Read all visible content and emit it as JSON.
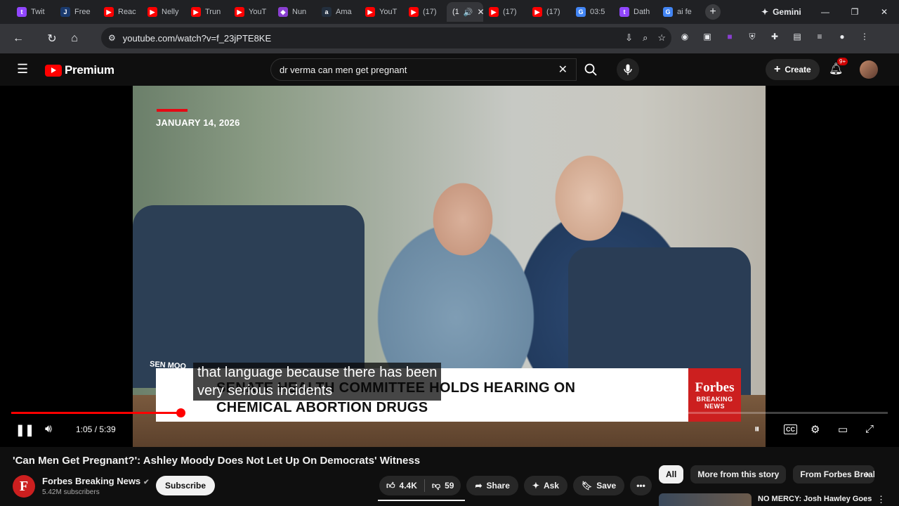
{
  "browser": {
    "tabs": [
      {
        "label": "Twit",
        "icon": "twitch-icon",
        "color": "#9146ff",
        "glyph": "t"
      },
      {
        "label": "Free",
        "icon": "j-icon",
        "color": "#1a3a6e",
        "glyph": "J"
      },
      {
        "label": "Reac",
        "icon": "youtube-icon",
        "color": "#ff0000",
        "glyph": "▶"
      },
      {
        "label": "Nelly",
        "icon": "youtube-icon",
        "color": "#ff0000",
        "glyph": "▶"
      },
      {
        "label": "Trun",
        "icon": "youtube-icon",
        "color": "#ff0000",
        "glyph": "▶"
      },
      {
        "label": "YouT",
        "icon": "youtube-icon",
        "color": "#ff0000",
        "glyph": "▶"
      },
      {
        "label": "Nun",
        "icon": "gem-icon",
        "color": "#8a3fd1",
        "glyph": "◆"
      },
      {
        "label": "Ama",
        "icon": "amazon-icon",
        "color": "#232f3e",
        "glyph": "a"
      },
      {
        "label": "YouT",
        "icon": "youtube-icon",
        "color": "#ff0000",
        "glyph": "▶"
      },
      {
        "label": "(17)",
        "icon": "youtube-icon",
        "color": "#ff0000",
        "glyph": "▶"
      }
    ],
    "active_tab": {
      "label": "(1",
      "icon": "audio-icon"
    },
    "tabs_after": [
      {
        "label": "(17)",
        "icon": "youtube-icon",
        "color": "#ff0000",
        "glyph": "▶"
      },
      {
        "label": "(17)",
        "icon": "youtube-icon",
        "color": "#ff0000",
        "glyph": "▶"
      },
      {
        "label": "03:5",
        "icon": "google-icon",
        "color": "#4285f4",
        "glyph": "G"
      },
      {
        "label": "Dath",
        "icon": "twitch-icon",
        "color": "#9146ff",
        "glyph": "t"
      },
      {
        "label": "ai fe",
        "icon": "google-icon",
        "color": "#4285f4",
        "glyph": "G"
      }
    ],
    "gemini_label": "Gemini",
    "url": "youtube.com/watch?v=f_23jPTE8KE"
  },
  "youtube": {
    "logo_text": "Premium",
    "search_query": "dr verma can men get pregnant",
    "create_label": "Create",
    "notifications_badge": "9+"
  },
  "video": {
    "date_overlay": "JANUARY 14, 2026",
    "lower_third_line1": "SENATE HEALTH COMMITTEE HOLDS HEARING ON",
    "lower_third_line2": "CHEMICAL ABORTION DRUGS",
    "brand_name": "Forbes",
    "brand_sub": "BREAKING NEWS",
    "nameplate": "SEN MOO",
    "caption_line1": "that language because there has been",
    "caption_line2": "very serious incidents",
    "time_display": "1:05 / 5:39",
    "progress_fraction": 0.193,
    "cc_label": "CC"
  },
  "meta": {
    "title": "'Can Men Get Pregnant?': Ashley Moody Does Not Let Up On Democrats' Witness",
    "channel_initial": "F",
    "channel_name": "Forbes Breaking News",
    "subscribers": "5.42M subscribers",
    "subscribe_label": "Subscribe",
    "likes": "4.4K",
    "dislikes": "59",
    "share_label": "Share",
    "ask_label": "Ask",
    "save_label": "Save"
  },
  "recommendations": {
    "chips": [
      "All",
      "More from this story",
      "From Forbes Breakin"
    ],
    "first_title": "NO MERCY: Josh Hawley Goes"
  }
}
